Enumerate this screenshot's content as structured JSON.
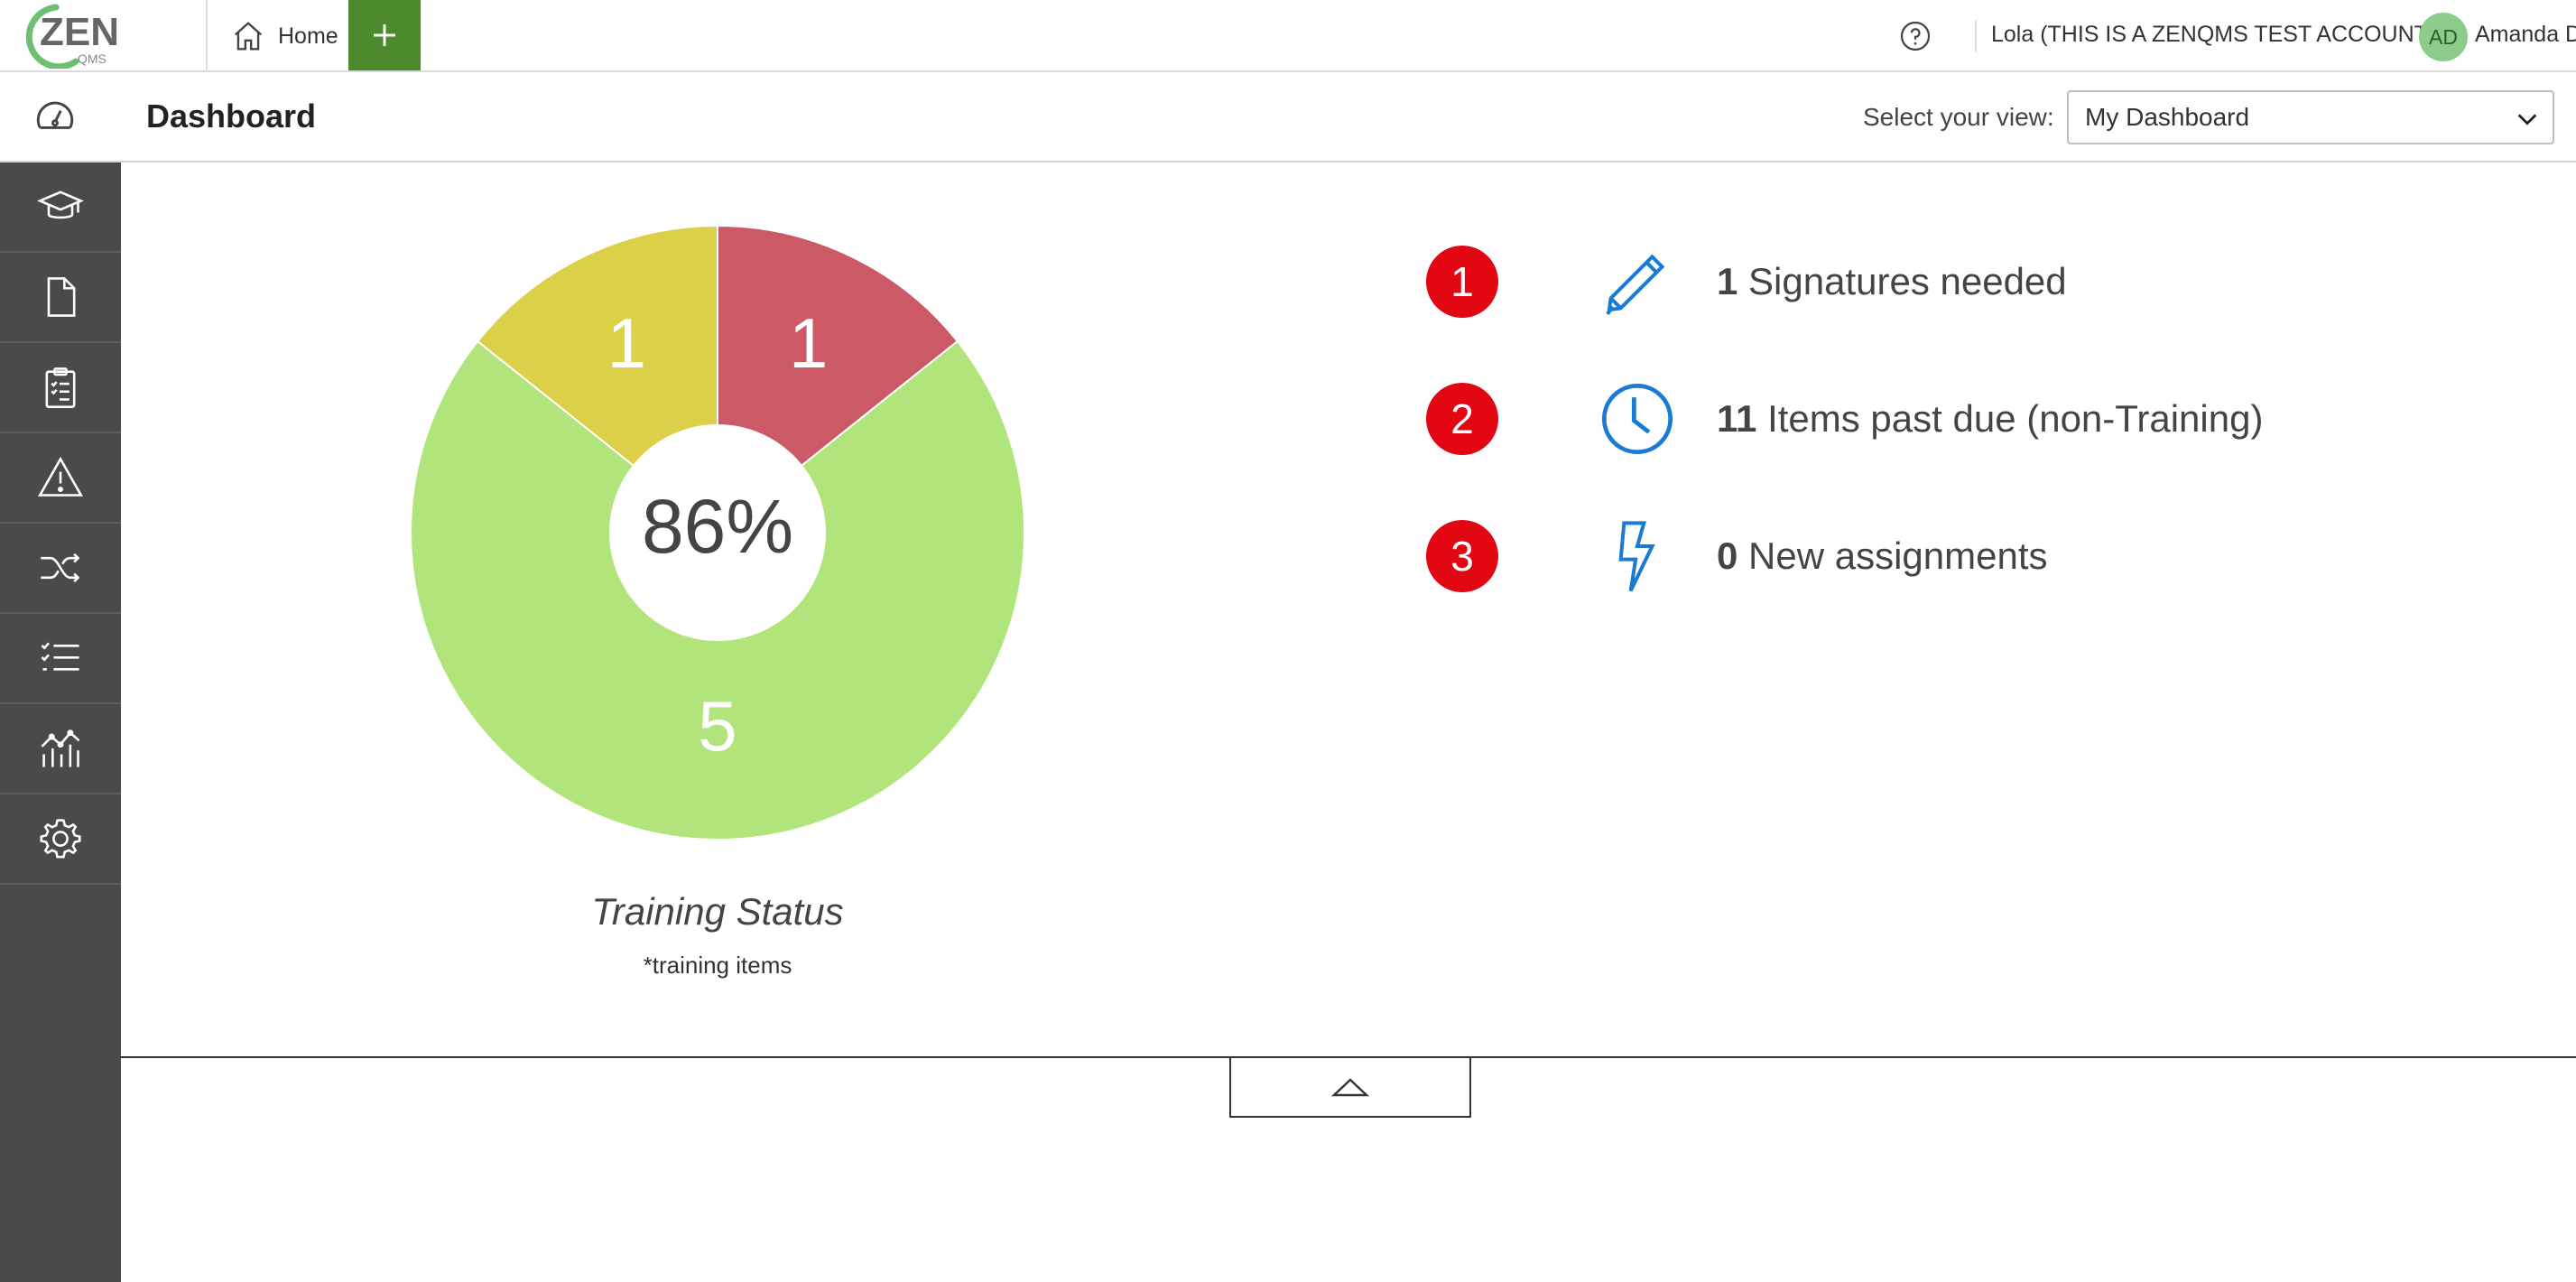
{
  "brand": {
    "logo_text": "ZEN",
    "logo_subtext": "QMS",
    "accent": "#4c8a2b"
  },
  "topbar": {
    "home_label": "Home",
    "account_name": "Lola (THIS IS A ZENQMS TEST ACCOUNT)",
    "avatar_initials": "AD",
    "user_name": "Amanda D"
  },
  "subheader": {
    "title": "Dashboard",
    "view_label": "Select your view:",
    "view_selected": "My Dashboard"
  },
  "sidebar": {
    "items": [
      {
        "name": "training",
        "icon": "graduation-cap-icon"
      },
      {
        "name": "documents",
        "icon": "document-icon"
      },
      {
        "name": "audits",
        "icon": "clipboard-checklist-icon"
      },
      {
        "name": "issues",
        "icon": "warning-icon"
      },
      {
        "name": "workflows",
        "icon": "shuffle-icon"
      },
      {
        "name": "checklists",
        "icon": "checklist-icon"
      },
      {
        "name": "reports",
        "icon": "chart-icon"
      },
      {
        "name": "settings",
        "icon": "gear-icon"
      }
    ]
  },
  "chart_data": {
    "type": "pie",
    "title": "Training Status",
    "subtitle": "*training items",
    "center_label": "86%",
    "categories": [
      "red",
      "green",
      "yellow"
    ],
    "values": [
      1,
      5,
      1
    ],
    "colors": [
      "#cc5966",
      "#b1e57b",
      "#dcd048"
    ]
  },
  "alerts": [
    {
      "badge": "1",
      "count": "1",
      "text": "Signatures needed",
      "icon": "pencil-icon"
    },
    {
      "badge": "2",
      "count": "11",
      "text": "Items past due (non-Training)",
      "icon": "clock-icon"
    },
    {
      "badge": "3",
      "count": "0",
      "text": "New assignments",
      "icon": "lightning-icon"
    }
  ],
  "colors": {
    "alert_badge": "#e30613",
    "icon_blue": "#1a7ad4",
    "sidebar_bg": "#4a4a4a"
  }
}
